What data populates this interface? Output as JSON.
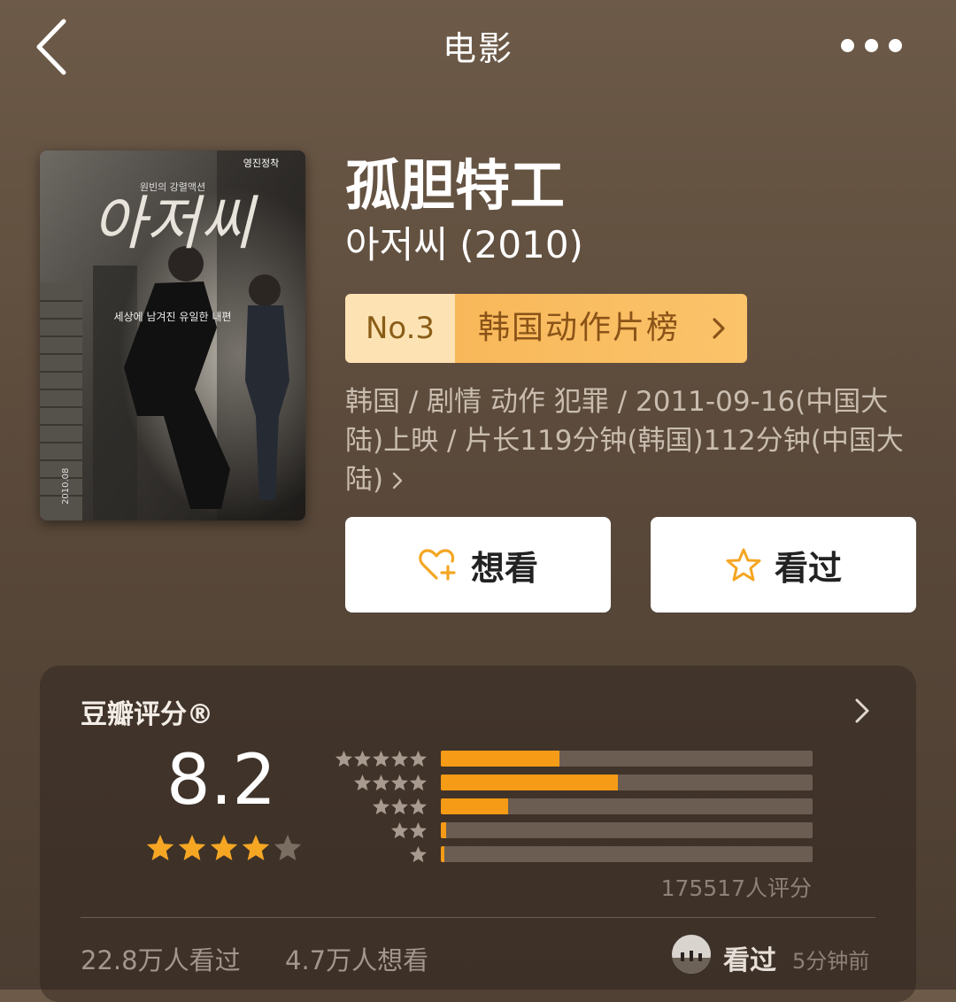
{
  "nav": {
    "title": "电影",
    "back_icon": "chevron-left-icon",
    "more_icon": "more-dots-icon"
  },
  "movie": {
    "title": "孤胆特工",
    "original_title": "아저씨 (2010)",
    "rank": {
      "number": "No.3",
      "list_name": "韩国动作片榜"
    },
    "meta": "韩国 / 剧情 动作 犯罪 / 2011-09-16(中国大陆)上映 / 片长119分钟(韩国)112分钟(中国大陆)",
    "poster": {
      "title_text": "아저씨",
      "tagline_top": "원빈의 강렬액션",
      "tagline_mid": "세상에 남겨진 유일한 내편",
      "sign": "영진정착",
      "date": "2010.08"
    }
  },
  "actions": {
    "want_label": "想看",
    "seen_label": "看过",
    "want_icon": "heart-plus-icon",
    "seen_icon": "star-outline-icon"
  },
  "rating": {
    "label": "豆瓣评分®",
    "score": "8.2",
    "stars": 4,
    "distribution": [
      {
        "stars": 5,
        "fraction": 0.32
      },
      {
        "stars": 4,
        "fraction": 0.475
      },
      {
        "stars": 3,
        "fraction": 0.18
      },
      {
        "stars": 2,
        "fraction": 0.015
      },
      {
        "stars": 1,
        "fraction": 0.004
      }
    ],
    "count_text": "175517人评分",
    "seen_text": "22.8万人看过",
    "want_text": "4.7万人想看",
    "friend_status": "看过",
    "friend_time": "5分钟前"
  },
  "colors": {
    "accent": "#f69b16",
    "background": "#5b4a3b"
  }
}
